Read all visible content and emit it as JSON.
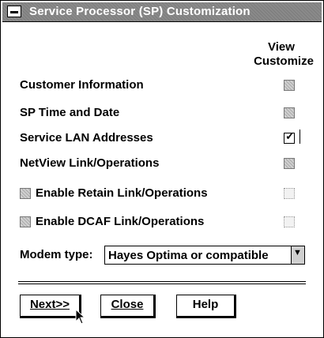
{
  "window": {
    "title": "Service Processor (SP) Customization"
  },
  "columns": {
    "view": "View",
    "customize": "Customize"
  },
  "rows": [
    {
      "label": "Customer Information",
      "state": "unchecked"
    },
    {
      "label": "SP Time and Date",
      "state": "unchecked"
    },
    {
      "label": "Service LAN Addresses",
      "state": "checked"
    },
    {
      "label": "NetView Link/Operations",
      "state": "unchecked"
    },
    {
      "label": "Enable Retain Link/Operations",
      "state": "disabled",
      "enable_checked": false
    },
    {
      "label": "Enable DCAF Link/Operations",
      "state": "disabled",
      "enable_checked": false
    }
  ],
  "modem": {
    "label": "Modem type:",
    "value": "Hayes Optima or compatible"
  },
  "buttons": {
    "next": "Next>>",
    "close": "Close",
    "help": "Help"
  },
  "icons": {
    "system_menu": "system-menu-icon",
    "dropdown": "chevron-down-icon",
    "cursor": "arrow-cursor-icon"
  }
}
